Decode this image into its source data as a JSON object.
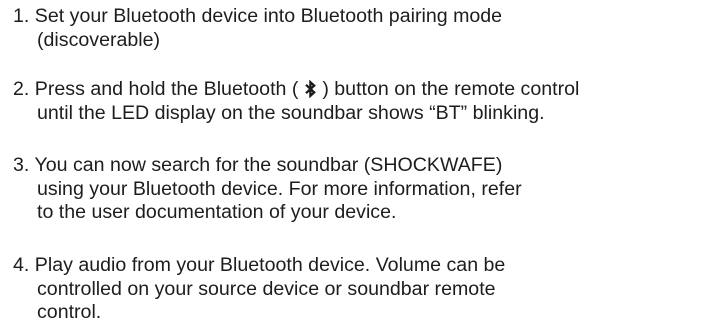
{
  "instructions": {
    "steps": [
      {
        "number": "1.",
        "lines": [
          "Set your Bluetooth device into Bluetooth pairing mode",
          "(discoverable)"
        ]
      },
      {
        "number": "2.",
        "line1_before_icon": "Press and hold the Bluetooth (",
        "icon": "bluetooth-icon",
        "line1_after_icon": ") button on the remote control",
        "line2": "until the LED display on the soundbar shows “BT” blinking."
      },
      {
        "number": "3.",
        "lines": [
          "You can now search for the soundbar (SHOCKWAFE)",
          "using your Bluetooth device. For more information, refer",
          "to the user documentation of your device."
        ]
      },
      {
        "number": "4.",
        "lines": [
          "Play audio from your Bluetooth device. Volume can be",
          "controlled on your source device or soundbar remote",
          "control."
        ]
      }
    ]
  }
}
